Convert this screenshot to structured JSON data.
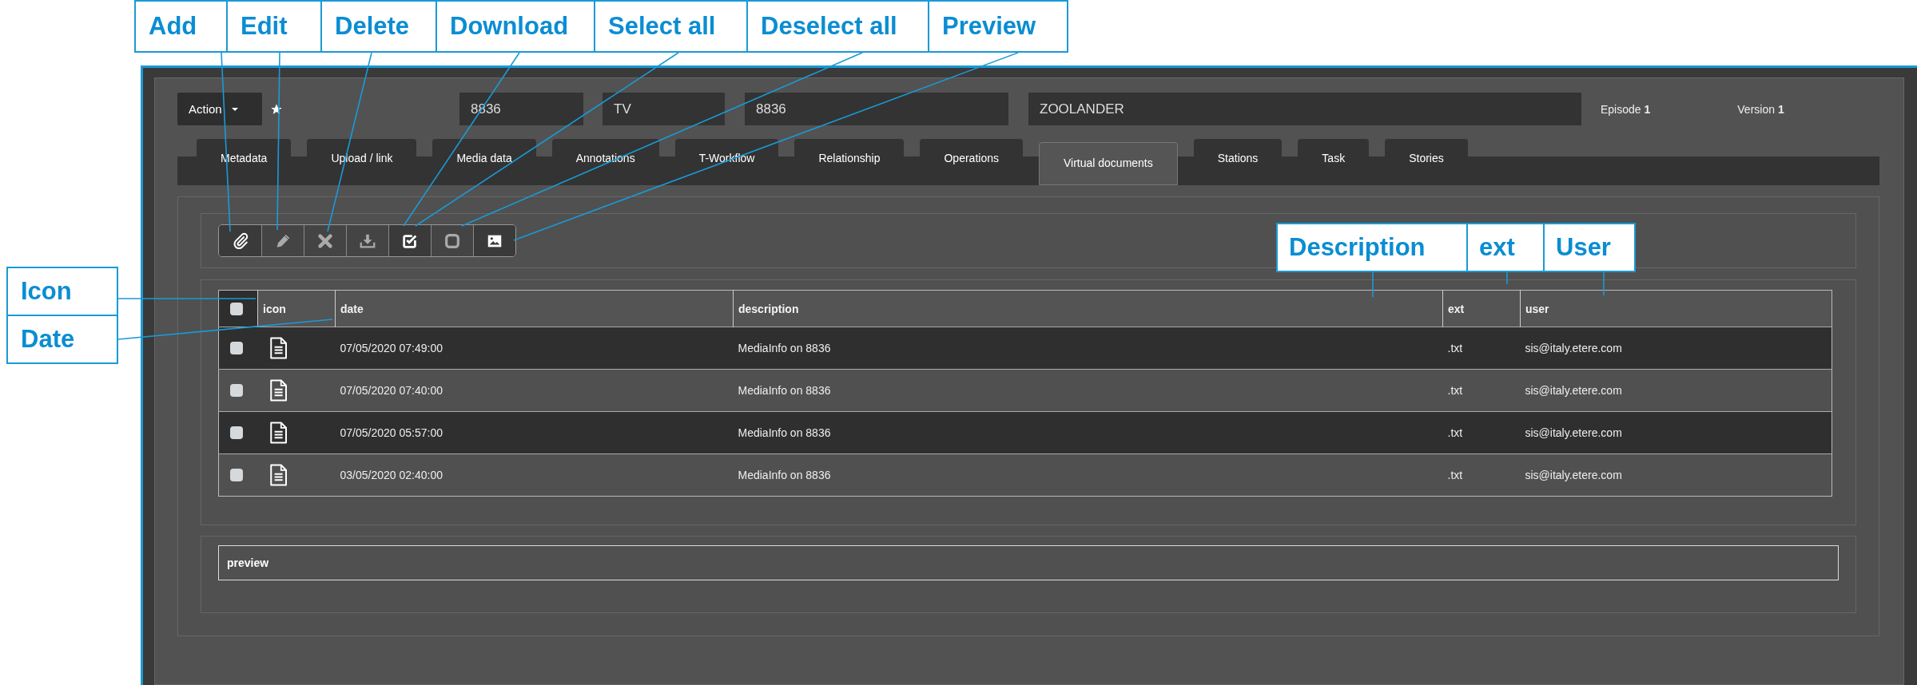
{
  "callouts_top": [
    "Add",
    "Edit",
    "Delete",
    "Download",
    "Select all",
    "Deselect all",
    "Preview"
  ],
  "callouts_left": [
    "Icon",
    "Date"
  ],
  "callouts_right": [
    "Description",
    "ext",
    "User"
  ],
  "header": {
    "action_button": "Action",
    "fields": [
      "8836",
      "TV",
      "8836",
      "ZOOLANDER"
    ],
    "episode": "Episode **1**",
    "version": "Version **1**"
  },
  "tabs": [
    {
      "label": "Metadata",
      "selected": false
    },
    {
      "label": "Upload / link",
      "selected": false
    },
    {
      "label": "Media data",
      "selected": false
    },
    {
      "label": "Annotations",
      "selected": false
    },
    {
      "label": "T-Workflow",
      "selected": false
    },
    {
      "label": "Relationship",
      "selected": false
    },
    {
      "label": "Operations",
      "selected": false
    },
    {
      "label": "Virtual documents",
      "selected": true
    },
    {
      "label": "Stations",
      "selected": false
    },
    {
      "label": "Task",
      "selected": false
    },
    {
      "label": "Stories",
      "selected": false
    }
  ],
  "toolbar": [
    {
      "kind": "attach",
      "disabled": false
    },
    {
      "kind": "edit",
      "disabled": true
    },
    {
      "kind": "delete",
      "disabled": true
    },
    {
      "kind": "download",
      "disabled": true
    },
    {
      "kind": "select_all",
      "disabled": false
    },
    {
      "kind": "deselect_all",
      "disabled": true
    },
    {
      "kind": "preview",
      "disabled": false
    }
  ],
  "table": {
    "columns": [
      "icon",
      "date",
      "description",
      "ext",
      "user"
    ],
    "header_checked": false,
    "rows": [
      {
        "checked": false,
        "date": "07/05/2020 07:49:00",
        "description": "MediaInfo on 8836",
        "ext": ".txt",
        "user": "sis@italy.etere.com"
      },
      {
        "checked": false,
        "date": "07/05/2020 07:40:00",
        "description": "MediaInfo on 8836",
        "ext": ".txt",
        "user": "sis@italy.etere.com"
      },
      {
        "checked": false,
        "date": "07/05/2020 05:57:00",
        "description": "MediaInfo on 8836",
        "ext": ".txt",
        "user": "sis@italy.etere.com"
      },
      {
        "checked": false,
        "date": "03/05/2020 02:40:00",
        "description": "MediaInfo on 8836",
        "ext": ".txt",
        "user": "sis@italy.etere.com"
      }
    ]
  },
  "preview": {
    "label": "preview"
  }
}
